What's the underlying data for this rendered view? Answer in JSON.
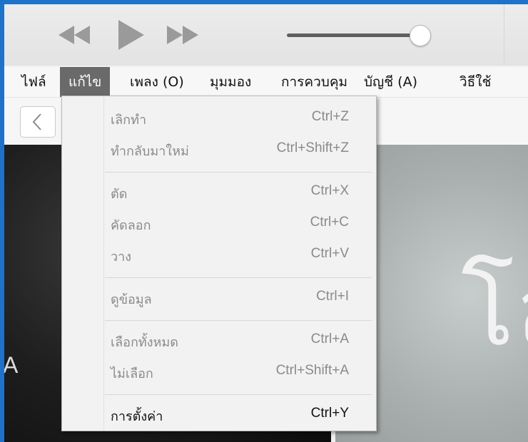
{
  "toolbar": {
    "rewind_icon": "rewind-icon",
    "play_icon": "play-icon",
    "forward_icon": "fast-forward-icon",
    "volume": 0.95
  },
  "menubar": {
    "items": [
      {
        "label": "ไฟล์"
      },
      {
        "label": "แก้ไข"
      },
      {
        "label": "เพลง (O)"
      },
      {
        "label": "มุมมอง"
      },
      {
        "label": "การควบคุม"
      },
      {
        "label": "บัญชี (A)"
      },
      {
        "label": "วิธีใช้"
      }
    ]
  },
  "nav": {
    "back_icon": "chevron-left-icon"
  },
  "dropdown": {
    "items": [
      {
        "label": "เลิกทำ",
        "shortcut": "Ctrl+Z"
      },
      {
        "label": "ทำกลับมาใหม่",
        "shortcut": "Ctrl+Shift+Z"
      },
      {
        "label": "ตัด",
        "shortcut": "Ctrl+X"
      },
      {
        "label": "คัดลอก",
        "shortcut": "Ctrl+C"
      },
      {
        "label": "วาง",
        "shortcut": "Ctrl+V"
      },
      {
        "label": "ดูข้อมูล",
        "shortcut": "Ctrl+I"
      },
      {
        "label": "เลือกทั้งหมด",
        "shortcut": "Ctrl+A"
      },
      {
        "label": "ไม่เลือก",
        "shortcut": "Ctrl+Shift+A"
      },
      {
        "label": "การตั้งค่า",
        "shortcut": "Ctrl+Y"
      }
    ]
  },
  "content": {
    "left_art_text": "A",
    "right_art_text": "โล"
  }
}
